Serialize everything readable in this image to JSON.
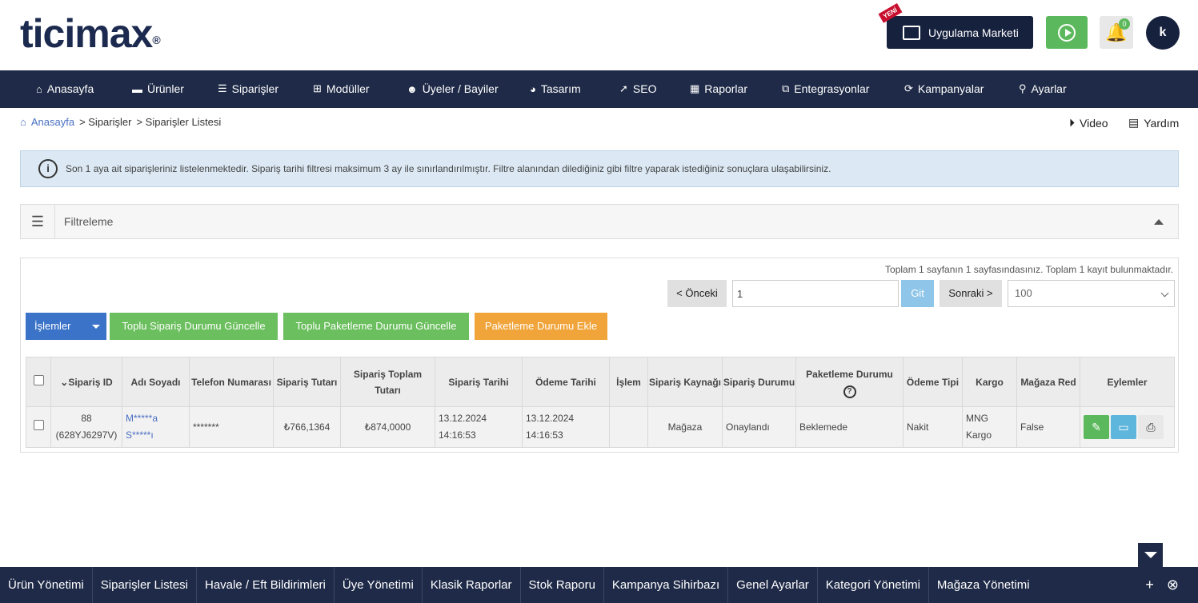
{
  "header": {
    "logo_text": "ticimax",
    "logo_mark": "®",
    "new_badge": "YENİ",
    "market_label": "Uygulama Marketi",
    "notification_count": "0",
    "user_initial": "k"
  },
  "nav": {
    "items": [
      {
        "label": "Anasayfa",
        "icon": "home-icon"
      },
      {
        "label": "Ürünler",
        "icon": "folder-icon"
      },
      {
        "label": "Siparişler",
        "icon": "list-icon"
      },
      {
        "label": "Modüller",
        "icon": "plus-box-icon"
      },
      {
        "label": "Üyeler / Bayiler",
        "icon": "users-icon"
      },
      {
        "label": "Tasarım",
        "icon": "palette-icon"
      },
      {
        "label": "SEO",
        "icon": "rocket-icon"
      },
      {
        "label": "Raporlar",
        "icon": "chart-icon"
      },
      {
        "label": "Entegrasyonlar",
        "icon": "integration-icon"
      },
      {
        "label": "Kampanyalar",
        "icon": "refresh-icon"
      },
      {
        "label": "Ayarlar",
        "icon": "wrench-icon"
      }
    ]
  },
  "breadcrumb": {
    "home": "Anasayfa",
    "level1": "> Siparişler",
    "level2": "> Siparişler Listesi",
    "video": "Video",
    "help": "Yardım"
  },
  "info": {
    "text": "Son 1 aya ait siparişleriniz listelenmektedir. Sipariş tarihi filtresi maksimum 3 ay ile sınırlandırılmıştır. Filtre alanından dilediğiniz gibi filtre yaparak istediğiniz sonuçlara ulaşabilirsiniz."
  },
  "filter": {
    "label": "Filtreleme"
  },
  "pagination": {
    "summary": "Toplam 1 sayfanın 1 sayfasındasınız. Toplam 1 kayıt bulunmaktadır.",
    "prev": "< Önceki",
    "page_value": "1",
    "go": "Git",
    "next": "Sonraki >",
    "page_size": "100"
  },
  "actions": {
    "islemler": "İşlemler",
    "bulk_status": "Toplu Sipariş Durumu Güncelle",
    "bulk_packaging": "Toplu Paketleme Durumu Güncelle",
    "add_packaging": "Paketleme Durumu Ekle"
  },
  "table": {
    "headers": {
      "order_id": "Sipariş ID",
      "name": "Adı Soyadı",
      "phone": "Telefon Numarası",
      "amount": "Sipariş Tutarı",
      "total": "Sipariş Toplam Tutarı",
      "order_date": "Sipariş Tarihi",
      "pay_date": "Ödeme Tarihi",
      "action": "İşlem",
      "source": "Sipariş Kaynağı",
      "status": "Sipariş Durumu",
      "packaging": "Paketleme Durumu",
      "pay_type": "Ödeme Tipi",
      "cargo": "Kargo",
      "store_red": "Mağaza Red",
      "ops": "Eylemler"
    },
    "rows": [
      {
        "id": "88",
        "code": "(628YJ6297V)",
        "name1": "M*****a",
        "name2": "S*****ı",
        "phone": "*******",
        "amount": "₺766,1364",
        "total": "₺874,0000",
        "order_date": "13.12.2024",
        "order_time": "14:16:53",
        "pay_date": "13.12.2024",
        "pay_time": "14:16:53",
        "action": "",
        "source": "Mağaza",
        "status": "Onaylandı",
        "packaging": "Beklemede",
        "pay_type": "Nakit",
        "cargo1": "MNG",
        "cargo2": "Kargo",
        "store_red": "False"
      }
    ]
  },
  "bottom_bar": {
    "items": [
      "Ürün Yönetimi",
      "Siparişler Listesi",
      "Havale / Eft Bildirimleri",
      "Üye Yönetimi",
      "Klasik Raporlar",
      "Stok Raporu",
      "Kampanya Sihirbazı",
      "Genel Ayarlar",
      "Kategori Yönetimi",
      "Mağaza Yönetimi"
    ]
  }
}
